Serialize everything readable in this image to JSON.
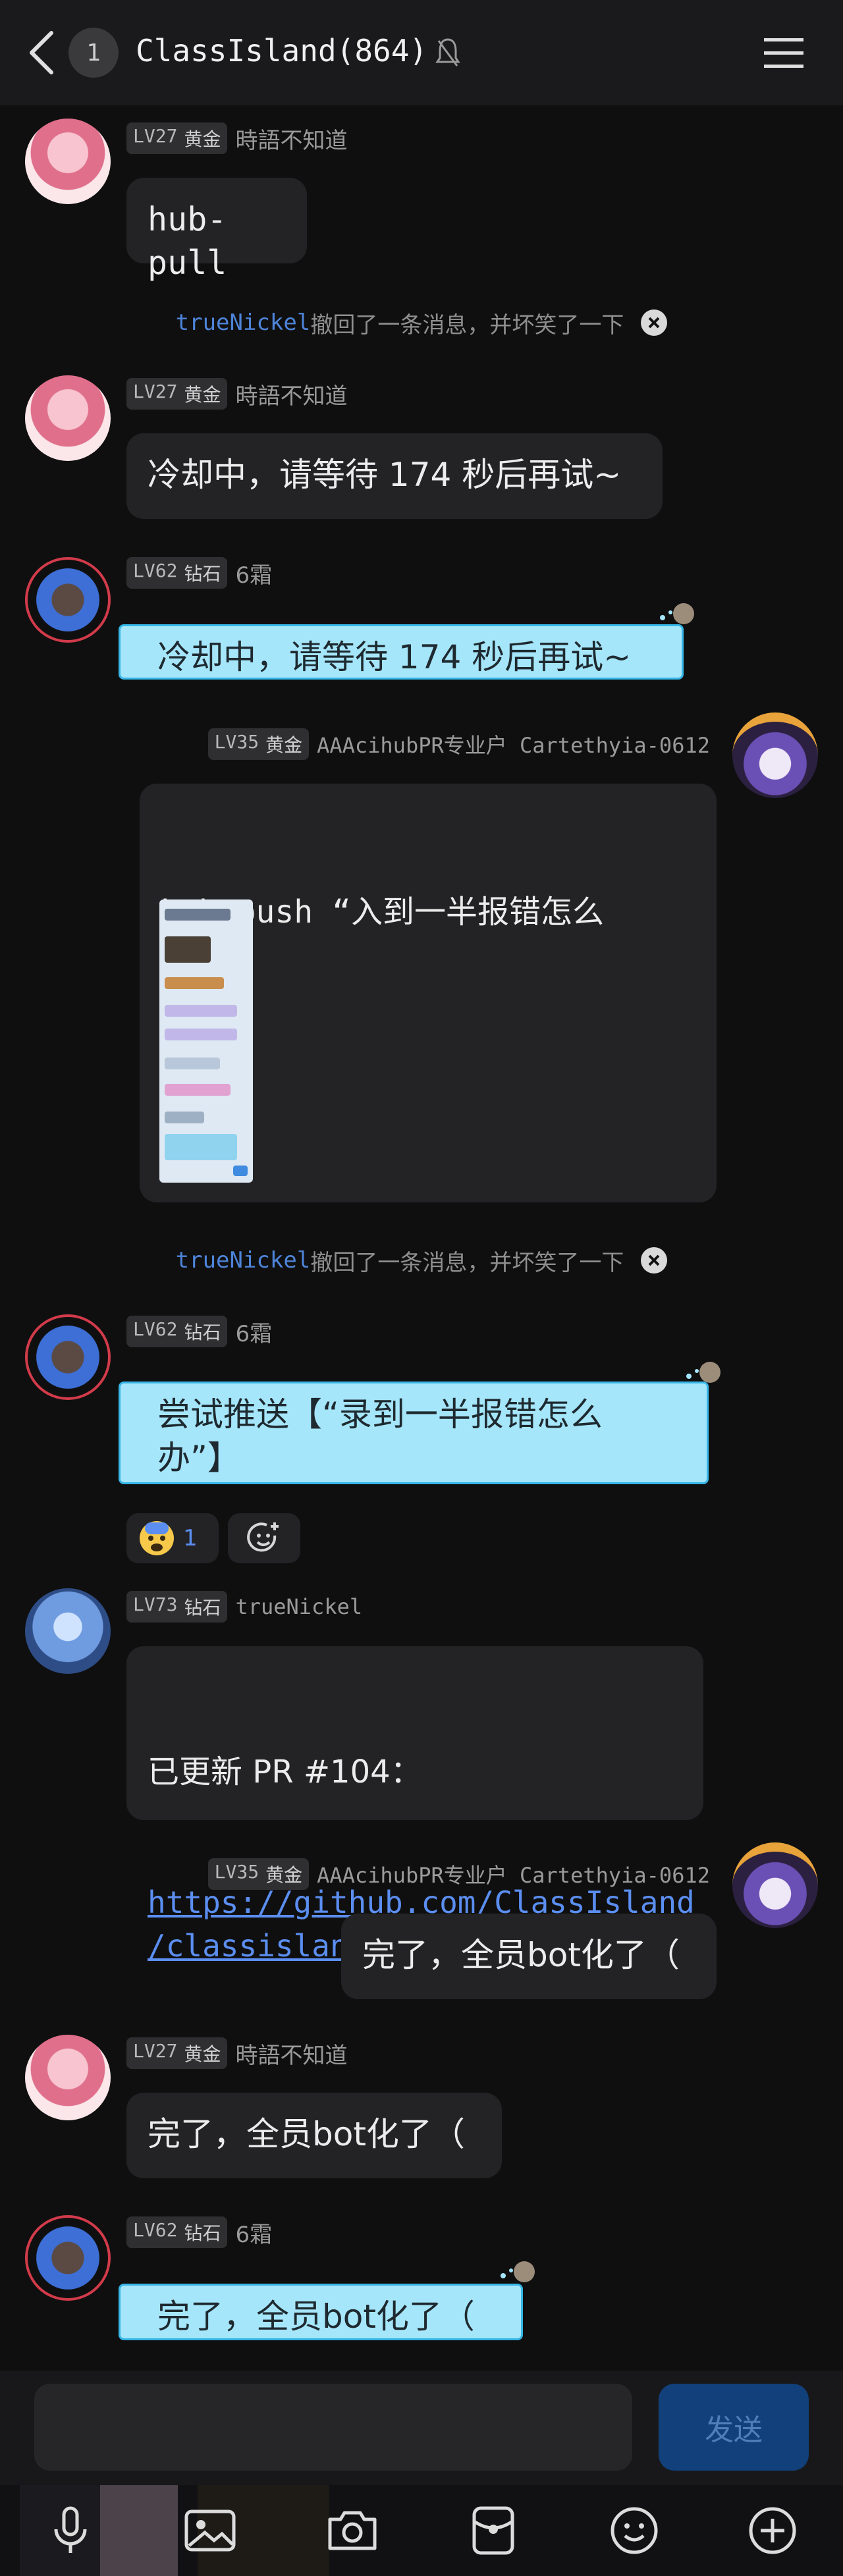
{
  "header": {
    "title": "ClassIsland(864)",
    "unread": "1"
  },
  "messages": {
    "m1": {
      "level": "LV27",
      "tier": "黄金",
      "name": "時語不知道",
      "text": "hub-pull"
    },
    "recall1": {
      "who": "trueNickel",
      "text": "撤回了一条消息，并坏笑了一下"
    },
    "m2": {
      "level": "LV27",
      "tier": "黄金",
      "name": "時語不知道",
      "text": "冷却中，请等待 174 秒后再试~"
    },
    "m3": {
      "level": "LV62",
      "tier": "钻石",
      "name": "6霜",
      "text": "冷却中，请等待 174 秒后再试~"
    },
    "m4": {
      "level": "LV35",
      "tier": "黄金",
      "name": "AAAcihubPR专业户 Cartethyia-0612",
      "text": "hub-push “入到一半报错怎么\n办”"
    },
    "recall2": {
      "who": "trueNickel",
      "text": "撤回了一条消息，并坏笑了一下"
    },
    "m5": {
      "level": "LV62",
      "tier": "钻石",
      "name": "6霜",
      "text": "尝试推送【“录到一半报错怎么\n办”】",
      "reaction_count": "1"
    },
    "m6": {
      "level": "LV73",
      "tier": "钻石",
      "name": "trueNickel",
      "text": "已更新 PR #104：",
      "link": "https://github.com/ClassIsland\n/classisland-hub/pull/104"
    },
    "m7": {
      "level": "LV35",
      "tier": "黄金",
      "name": "AAAcihubPR专业户 Cartethyia-0612",
      "text": "完了，全员bot化了（"
    },
    "m8": {
      "level": "LV27",
      "tier": "黄金",
      "name": "時語不知道",
      "text": "完了，全员bot化了（"
    },
    "m9": {
      "level": "LV62",
      "tier": "钻石",
      "name": "6霜",
      "text": "完了，全员bot化了（"
    }
  },
  "input": {
    "placeholder": "",
    "send_label": "发送"
  },
  "colors": {
    "bot_bubble": "#a6e6fb",
    "link": "#5b8ef0",
    "send": "#11407a"
  }
}
